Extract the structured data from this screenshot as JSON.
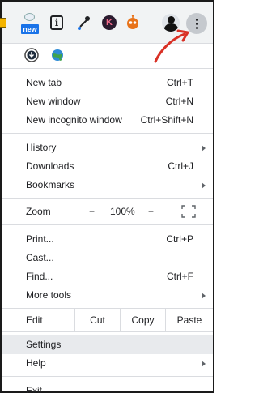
{
  "toolbar": {
    "new_badge": "new",
    "info_glyph": "i",
    "k_glyph": "K",
    "icons": [
      "extension-yellow-icon",
      "new-extension-icon",
      "info-extension-icon",
      "eyedropper-extension-icon",
      "k-extension-icon",
      "robot-extension-icon",
      "profile-avatar",
      "more-menu-icon"
    ]
  },
  "menu": {
    "extension_icons": [
      "download-icon",
      "globe-icon"
    ],
    "group1": [
      {
        "label": "New tab",
        "shortcut": "Ctrl+T"
      },
      {
        "label": "New window",
        "shortcut": "Ctrl+N"
      },
      {
        "label": "New incognito window",
        "shortcut": "Ctrl+Shift+N"
      }
    ],
    "group2": [
      {
        "label": "History",
        "shortcut": ""
      },
      {
        "label": "Downloads",
        "shortcut": "Ctrl+J"
      },
      {
        "label": "Bookmarks",
        "shortcut": ""
      }
    ],
    "zoom": {
      "label": "Zoom",
      "minus": "−",
      "value": "100%",
      "plus": "+"
    },
    "group3": [
      {
        "label": "Print...",
        "shortcut": "Ctrl+P"
      },
      {
        "label": "Cast...",
        "shortcut": ""
      },
      {
        "label": "Find...",
        "shortcut": "Ctrl+F"
      },
      {
        "label": "More tools",
        "shortcut": ""
      }
    ],
    "edit": {
      "label": "Edit",
      "cut": "Cut",
      "copy": "Copy",
      "paste": "Paste"
    },
    "settings": "Settings",
    "help": "Help",
    "exit": "Exit"
  },
  "colors": {
    "toolbar_bg": "#f1f3f4",
    "highlight": "#e8eaed",
    "arrow": "#d93025"
  }
}
